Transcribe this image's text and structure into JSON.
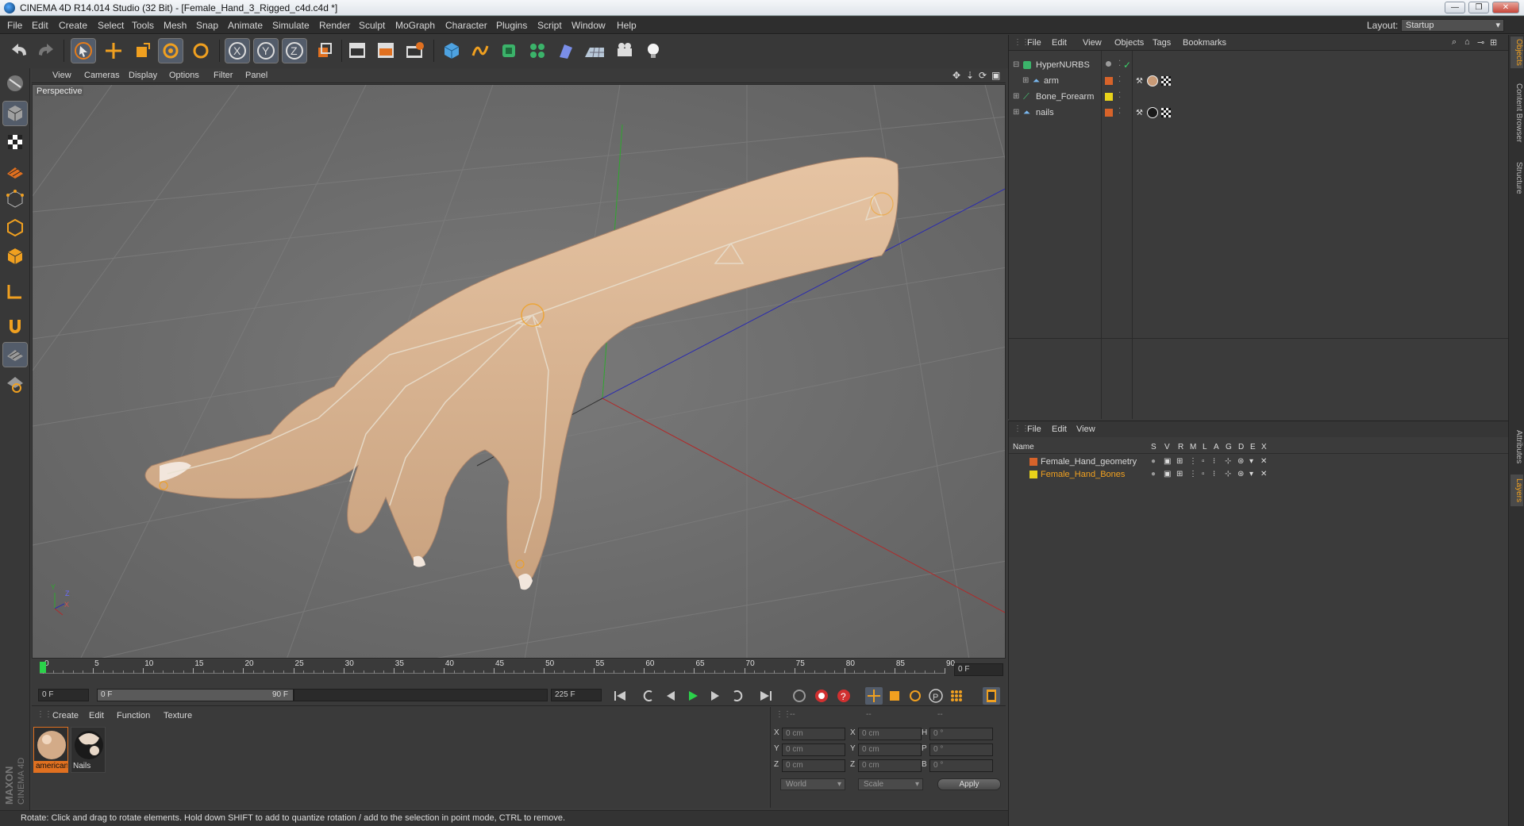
{
  "window": {
    "title": "CINEMA 4D R14.014 Studio (32 Bit) - [Female_Hand_3_Rigged_c4d.c4d *]",
    "min": "—",
    "max": "❐",
    "close": "✕"
  },
  "menu": {
    "items": [
      "File",
      "Edit",
      "Create",
      "Select",
      "Tools",
      "Mesh",
      "Snap",
      "Animate",
      "Simulate",
      "Render",
      "Sculpt",
      "MoGraph",
      "Character",
      "Plugins",
      "Script",
      "Window",
      "Help"
    ],
    "layout_label": "Layout:",
    "layout_value": "Startup"
  },
  "viewport": {
    "menu": [
      "View",
      "Cameras",
      "Display",
      "Options",
      "Filter",
      "Panel"
    ],
    "camera": "Perspective",
    "axis_y": "Y",
    "axis_z": "Z",
    "axis_x": "X"
  },
  "timeline": {
    "ticks": [
      "0",
      "5",
      "10",
      "15",
      "20",
      "25",
      "30",
      "35",
      "40",
      "45",
      "50",
      "55",
      "60",
      "65",
      "70",
      "75",
      "80",
      "85",
      "90"
    ],
    "current_frame": "0 F"
  },
  "transport": {
    "start": "0 F",
    "range_start": "0 F",
    "range_end": "90 F",
    "end": "225 F"
  },
  "materials": {
    "menu": [
      "Create",
      "Edit",
      "Function",
      "Texture"
    ],
    "items": [
      {
        "label": "american"
      },
      {
        "label": "Nails"
      }
    ]
  },
  "coords": {
    "header1": "--",
    "header2": "--",
    "header3": "--",
    "rows": [
      {
        "a": "X",
        "av": "0 cm",
        "b": "X",
        "bv": "0 cm",
        "c": "H",
        "cv": "0 °"
      },
      {
        "a": "Y",
        "av": "0 cm",
        "b": "Y",
        "bv": "0 cm",
        "c": "P",
        "cv": "0 °"
      },
      {
        "a": "Z",
        "av": "0 cm",
        "b": "Z",
        "bv": "0 cm",
        "c": "B",
        "cv": "0 °"
      }
    ],
    "world": "World",
    "scale": "Scale",
    "apply": "Apply"
  },
  "status": "Rotate: Click and drag to rotate elements. Hold down SHIFT to add to quantize rotation / add to the selection in point mode, CTRL to remove.",
  "objects": {
    "menu": [
      "File",
      "Edit",
      "View",
      "Objects",
      "Tags",
      "Bookmarks"
    ],
    "rows": [
      {
        "name": "HyperNURBS",
        "color": "#9a9a9a"
      },
      {
        "name": "arm",
        "color": "#d7632a"
      },
      {
        "name": "Bone_Forearm",
        "color": "#e8d21a"
      },
      {
        "name": "nails",
        "color": "#d7632a"
      }
    ]
  },
  "layers": {
    "menu": [
      "File",
      "Edit",
      "View"
    ],
    "headers": [
      "Name",
      "S",
      "V",
      "R",
      "M",
      "L",
      "A",
      "G",
      "D",
      "E",
      "X"
    ],
    "rows": [
      {
        "name": "Female_Hand_geometry",
        "color": "#d7632a"
      },
      {
        "name": "Female_Hand_Bones",
        "color": "#e8d21a"
      }
    ]
  },
  "side_tabs": [
    "Objects",
    "Content Browser",
    "Structure",
    "Attributes",
    "Layers"
  ],
  "brand": {
    "maxon": "MAXON",
    "product": "CINEMA 4D"
  }
}
